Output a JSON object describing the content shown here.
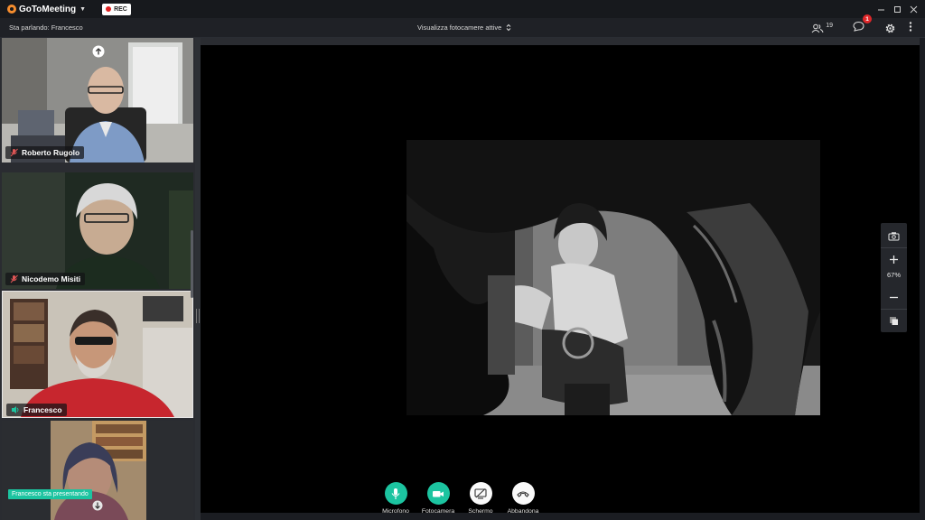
{
  "app": {
    "name": "GoToMeeting",
    "rec_label": "REC"
  },
  "infobar": {
    "speaking_text": "Sta parlando: Francesco",
    "view_select_label": "Visualizza fotocamere attive",
    "attendee_count": "19",
    "chat_badge_count": "1"
  },
  "participants": [
    {
      "name": "Roberto Rugolo",
      "mic": "muted"
    },
    {
      "name": "Nicodemo Misiti",
      "mic": "muted"
    },
    {
      "name": "Francesco",
      "mic": "speaking"
    },
    {
      "name": "",
      "mic": "none"
    }
  ],
  "presenting_text": "Francesco sta presentando",
  "zoom": {
    "level": "67%"
  },
  "controls": [
    {
      "label": "Microfono",
      "icon": "microphone-icon",
      "color": "#1cc4a0"
    },
    {
      "label": "Fotocamera",
      "icon": "camera-icon",
      "color": "#1cc4a0"
    },
    {
      "label": "Schermo",
      "icon": "screen-share-icon",
      "color": "#fafafa"
    },
    {
      "label": "Abbandona",
      "icon": "hang-up-icon",
      "color": "#fafafa"
    }
  ],
  "colors": {
    "accent": "#1cc4a0",
    "badge": "#e0272a",
    "background": "#1b1d22",
    "brand": "#f68d2e"
  }
}
